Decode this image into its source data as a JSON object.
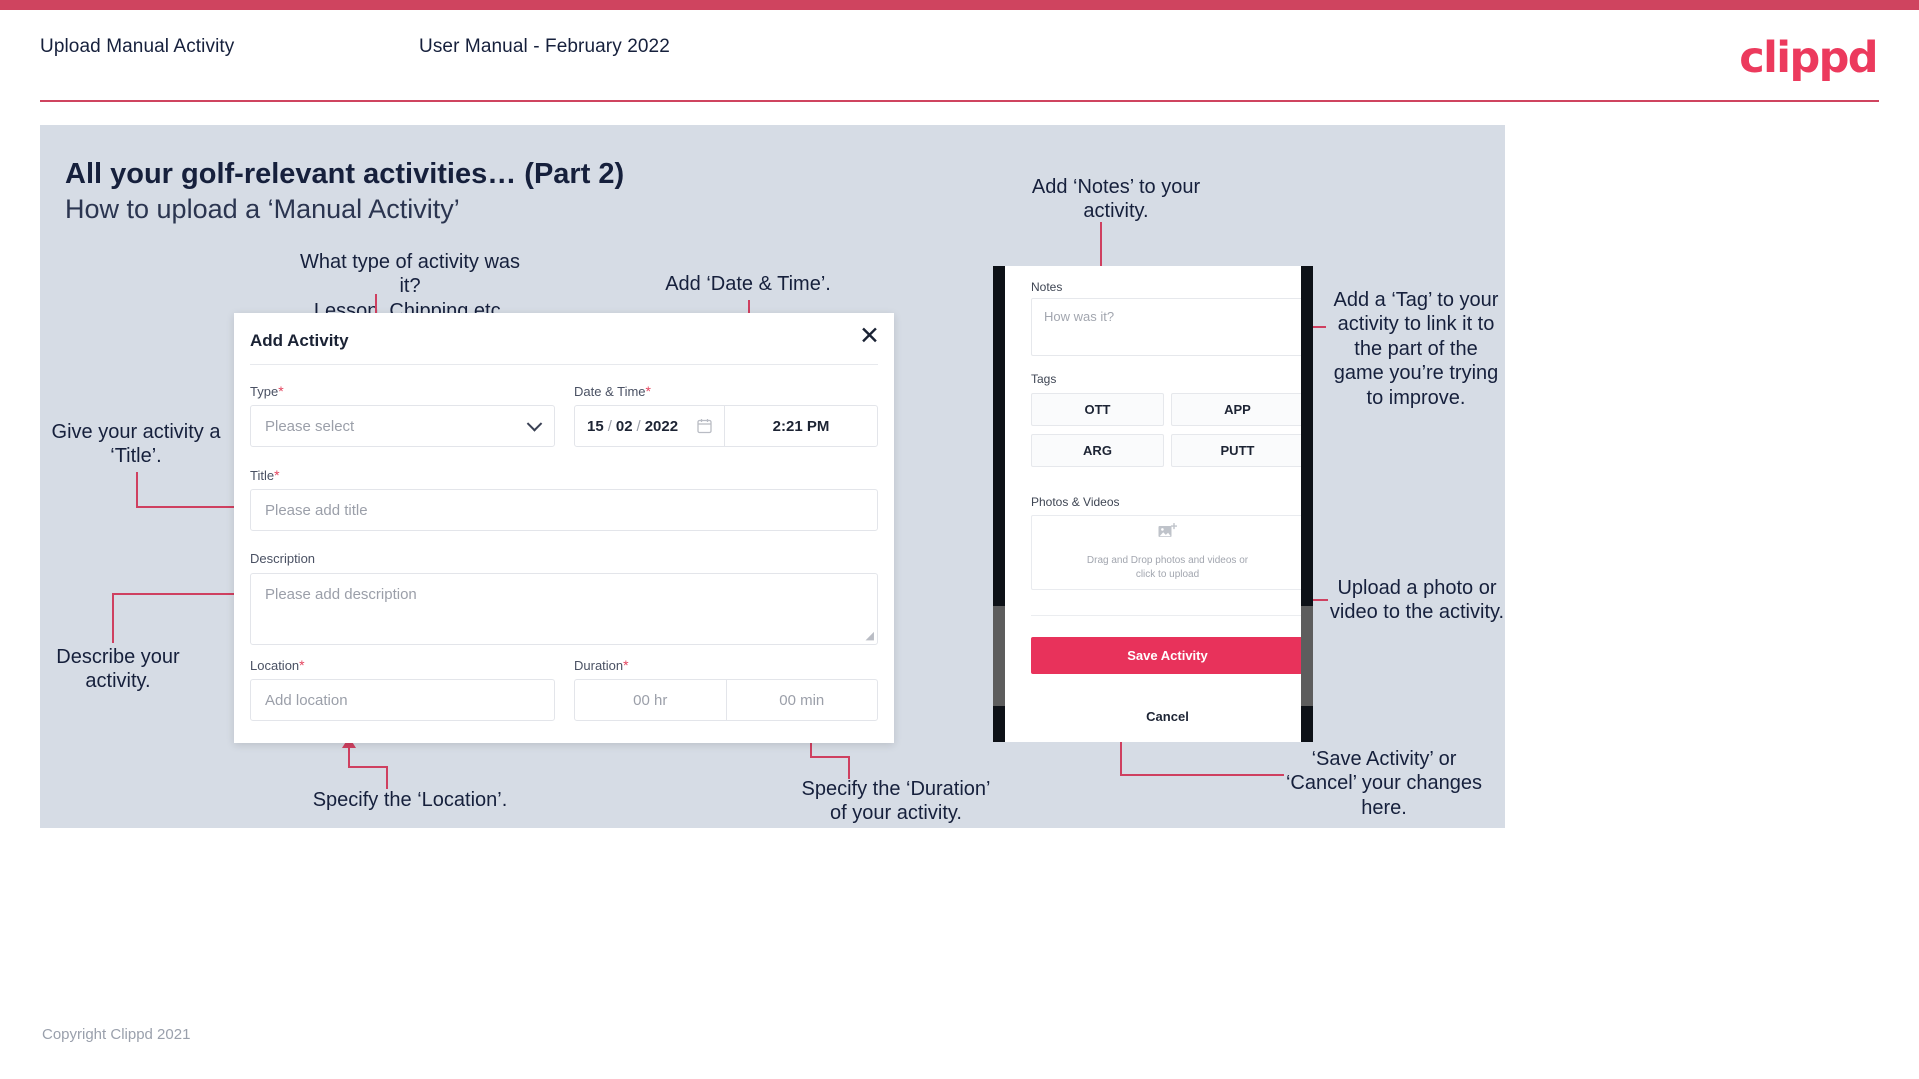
{
  "header": {
    "left_title": "Upload Manual Activity",
    "center_title": "User Manual - February 2022",
    "logo": "clippd"
  },
  "slide": {
    "title": "All your golf-relevant activities… (Part 2)",
    "subtitle": "How to upload a ‘Manual Activity’"
  },
  "annotations": {
    "type": "What type of activity was it?\nLesson, Chipping etc.",
    "date_time": "Add ‘Date & Time’.",
    "title": "Give your activity a\n‘Title’.",
    "description": "Describe your\nactivity.",
    "location": "Specify the ‘Location’.",
    "duration": "Specify the ‘Duration’\nof your activity.",
    "notes": "Add ‘Notes’ to your\nactivity.",
    "tags": "Add a ‘Tag’ to your\nactivity to link it to\nthe part of the\ngame you’re trying\nto improve.",
    "photos": "Upload a photo or\nvideo to the activity.",
    "save_cancel": "‘Save Activity’ or\n‘Cancel’ your changes\nhere."
  },
  "dialog": {
    "title": "Add Activity",
    "close_icon": "✕",
    "type": {
      "label": "Type",
      "required": "*",
      "placeholder": "Please select"
    },
    "date_time": {
      "label": "Date & Time",
      "required": "*",
      "day": "15",
      "month": "02",
      "year": "2022",
      "sep": "/",
      "time": "2:21 PM"
    },
    "title_field": {
      "label": "Title",
      "required": "*",
      "placeholder": "Please add title"
    },
    "description": {
      "label": "Description",
      "placeholder": "Please add description"
    },
    "location": {
      "label": "Location",
      "required": "*",
      "placeholder": "Add location"
    },
    "duration": {
      "label": "Duration",
      "required": "*",
      "hours": "00 hr",
      "minutes": "00 min"
    }
  },
  "phone": {
    "notes": {
      "label": "Notes",
      "placeholder": "How was it?"
    },
    "tags": {
      "label": "Tags",
      "items": [
        "OTT",
        "APP",
        "ARG",
        "PUTT"
      ]
    },
    "photos": {
      "label": "Photos & Videos",
      "drop_text": "Drag and Drop photos and videos or\nclick to upload"
    },
    "save_label": "Save Activity",
    "cancel_label": "Cancel"
  },
  "footer": "Copyright Clippd 2021",
  "colors": {
    "brand_pink": "#ec3a5d",
    "accent_line": "#cf4060",
    "slide_bg": "#d6dce5",
    "text_dark": "#16203c",
    "save_button": "#e8325b"
  }
}
